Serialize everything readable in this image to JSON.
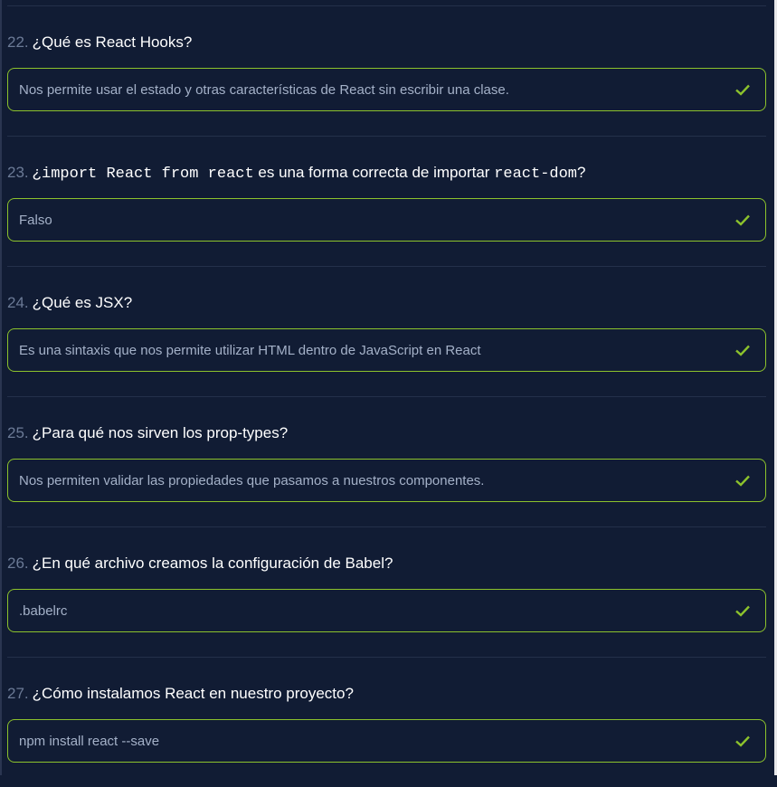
{
  "questions": [
    {
      "number": "22.",
      "parts": [
        {
          "t": "¿Qué es React Hooks?"
        }
      ],
      "answer": "Nos permite usar el estado y otras características de React sin escribir una clase."
    },
    {
      "number": "23.",
      "parts": [
        {
          "t": "¿"
        },
        {
          "code": "import React from react"
        },
        {
          "t": " es una forma correcta de importar "
        },
        {
          "code": "react-dom"
        },
        {
          "t": "?"
        }
      ],
      "answer": "Falso"
    },
    {
      "number": "24.",
      "parts": [
        {
          "t": "¿Qué es JSX?"
        }
      ],
      "answer": "Es una sintaxis que nos permite utilizar HTML dentro de JavaScript en React"
    },
    {
      "number": "25.",
      "parts": [
        {
          "t": "¿Para qué nos sirven los prop-types?"
        }
      ],
      "answer": "Nos permiten validar las propiedades que pasamos a nuestros componentes."
    },
    {
      "number": "26.",
      "parts": [
        {
          "t": "¿En qué archivo creamos la configuración de Babel?"
        }
      ],
      "answer": ".babelrc"
    },
    {
      "number": "27.",
      "parts": [
        {
          "t": "¿Cómo instalamos React en nuestro proyecto?"
        }
      ],
      "answer": "npm install react --save"
    }
  ],
  "colors": {
    "correct": "#8cc22c",
    "background": "#111c34"
  }
}
